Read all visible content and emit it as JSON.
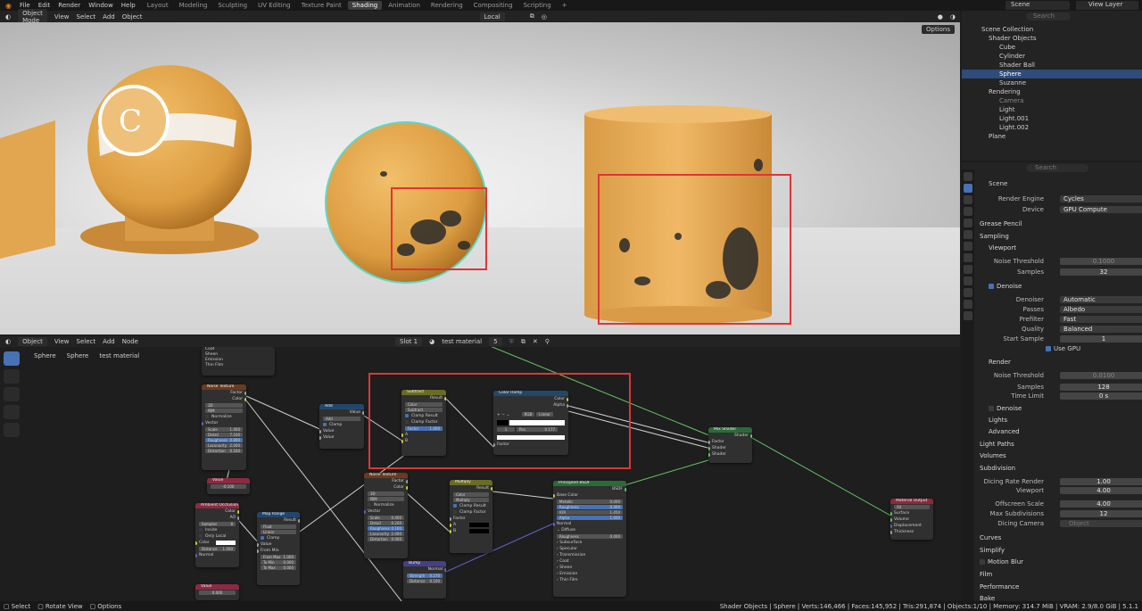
{
  "topbar": {
    "menus": [
      "File",
      "Edit",
      "Render",
      "Window",
      "Help"
    ],
    "workspaces": [
      "Layout",
      "Modeling",
      "Sculpting",
      "UV Editing",
      "Texture Paint",
      "Shading",
      "Animation",
      "Rendering",
      "Compositing",
      "Scripting"
    ],
    "active_workspace": "Shading",
    "scene": "Scene",
    "view_layer": "View Layer"
  },
  "viewport_header": {
    "mode": "Object Mode",
    "menus": [
      "View",
      "Select",
      "Add",
      "Object"
    ],
    "orientation": "Local",
    "options": "Options"
  },
  "outliner": {
    "search_placeholder": "Search",
    "root": "Scene Collection",
    "rows": [
      {
        "label": "Shader Objects"
      },
      {
        "label": "Cube"
      },
      {
        "label": "Cylinder"
      },
      {
        "label": "Shader Ball"
      },
      {
        "label": "Sphere"
      },
      {
        "label": "Suzanne"
      },
      {
        "label": "Rendering"
      },
      {
        "label": "Camera"
      },
      {
        "label": "Light"
      },
      {
        "label": "Light.001"
      },
      {
        "label": "Light.002"
      },
      {
        "label": "Plane"
      }
    ]
  },
  "properties": {
    "search_placeholder": "Search",
    "breadcrumb": "Scene",
    "render_engine_label": "Render Engine",
    "render_engine": "Cycles",
    "device_label": "Device",
    "device": "GPU Compute",
    "grease_pencil": "Grease Pencil",
    "sampling": "Sampling",
    "viewport": "Viewport",
    "noise_threshold_label": "Noise Threshold",
    "vp_noise_threshold": "0.1000",
    "samples_label": "Samples",
    "vp_samples": "32",
    "denoise": "Denoise",
    "denoiser_label": "Denoiser",
    "denoiser": "Automatic",
    "passes_label": "Passes",
    "passes": "Albedo",
    "prefilter_label": "Prefilter",
    "prefilter": "Fast",
    "quality_label": "Quality",
    "quality": "Balanced",
    "start_sample_label": "Start Sample",
    "start_sample": "1",
    "use_gpu": "Use GPU",
    "render": "Render",
    "r_noise_threshold": "0.0100",
    "r_samples": "128",
    "time_limit_label": "Time Limit",
    "time_limit": "0 s",
    "denoise2": "Denoise",
    "lights": "Lights",
    "advanced": "Advanced",
    "light_paths": "Light Paths",
    "volumes": "Volumes",
    "subdivision": "Subdivision",
    "dicing_rate_render_label": "Dicing Rate Render",
    "dicing_rate_render": "1.00",
    "dicing_viewport_label": "Viewport",
    "dicing_viewport": "4.00",
    "offscreen_scale_label": "Offscreen Scale",
    "offscreen_scale": "4.00",
    "max_subdivisions_label": "Max Subdivisions",
    "max_subdivisions": "12",
    "dicing_camera_label": "Dicing Camera",
    "dicing_camera_placeholder": "Object",
    "curves": "Curves",
    "simplify": "Simplify",
    "motion_blur": "Motion Blur",
    "film": "Film",
    "performance": "Performance",
    "bake": "Bake"
  },
  "node_header": {
    "editor_type": "Object",
    "menus": [
      "View",
      "Select",
      "Add",
      "Node"
    ],
    "slot": "Slot 1",
    "material": "test material",
    "users": "5"
  },
  "breadcrumbs": [
    "Sphere",
    "Sphere",
    "test material"
  ],
  "nodes": {
    "noise1": {
      "title": "Noise Texture",
      "out1": "Factor",
      "out2": "Color",
      "dim": "3D",
      "type": "fBM",
      "normalize": "Normalize",
      "vector": "Vector",
      "scale": "Scale",
      "scale_v": "1.400",
      "detail": "Detail",
      "detail_v": "7.100",
      "rough": "Roughness",
      "rough_v": "0.800",
      "lac": "Lacunarity",
      "lac_v": "2.000",
      "dist": "Distortion",
      "dist_v": "0.160"
    },
    "add": {
      "title": "Add",
      "out": "Value",
      "op": "Add",
      "clamp": "Clamp",
      "in1": "Value",
      "in2": "Value"
    },
    "value1": {
      "value": "-0.100"
    },
    "subtract": {
      "title": "Subtract",
      "out": "Result",
      "mode": "Color",
      "op": "Subtract",
      "clamp_result": "Clamp Result",
      "clamp_factor": "Clamp Factor",
      "factor": "Factor",
      "factor_v": "1.000",
      "a": "A",
      "b": "B"
    },
    "ramp": {
      "title": "Color Ramp",
      "out1": "Color",
      "out2": "Alpha",
      "mode": "RGB",
      "interp": "Linear",
      "idx": "1",
      "pos_label": "Pos",
      "pos": "0.177",
      "fac": "Factor"
    },
    "mix": {
      "title": "Mix Shader",
      "out": "Shader",
      "fac": "Factor",
      "s1": "Shader",
      "s2": "Shader"
    },
    "ao": {
      "title": "Ambient Occlusion",
      "out1": "Color",
      "out2": "AO",
      "samples": "Samples",
      "samples_v": "8",
      "inside": "Inside",
      "only_local": "Only Local",
      "color": "Color",
      "distance": "Distance",
      "distance_v": "1.000",
      "normal": "Normal"
    },
    "maprange": {
      "title": "Map Range",
      "out": "Result",
      "type": "Float",
      "interp": "Linear",
      "clamp": "Clamp",
      "value": "Value",
      "from_min": "From Min",
      "from_max": "From Max",
      "from_max_v": "1.000",
      "to_min": "To Min",
      "to_min_v": "0.000",
      "to_max": "To Max",
      "to_max_v": "0.000"
    },
    "noise2": {
      "title": "Noise Texture",
      "out1": "Factor",
      "out2": "Color",
      "dim": "3D",
      "type": "fBM",
      "normalize": "Normalize",
      "vector": "Vector",
      "scale": "Scale",
      "scale_v": "0.400",
      "detail": "Detail",
      "detail_v": "0.200",
      "rough": "Roughness",
      "rough_v": "0.100",
      "lac": "Lacunarity",
      "lac_v": "2.000",
      "dist": "Distortion",
      "dist_v": "0.000"
    },
    "multiply": {
      "title": "Multiply",
      "out": "Result",
      "mode": "Color",
      "op": "Multiply",
      "clamp_result": "Clamp Result",
      "clamp_factor": "Clamp Factor",
      "factor": "Factor",
      "a": "A",
      "b": "B"
    },
    "bump": {
      "title": "Bump",
      "out": "Normal",
      "strength": "Strength",
      "strength_v": "0.270",
      "distance": "Distance",
      "distance_v": "0.100"
    },
    "bsdf": {
      "title": "Principled BSDF",
      "out": "BSDF",
      "base_color": "Base Color",
      "metallic": "Metallic",
      "metallic_v": "0.000",
      "roughness": "Roughness",
      "roughness_v": "0.400",
      "ior": "IOR",
      "ior_v": "1.450",
      "alpha": "Alpha",
      "alpha_v": "1.000",
      "normal": "Normal",
      "diffuse": "Diffuse",
      "rough_label": "Roughness",
      "rough2_v": "0.000",
      "subsurface": "Subsurface",
      "specular": "Specular",
      "transmission": "Transmission",
      "coat": "Coat",
      "sheen": "Sheen",
      "emission": "Emission",
      "thin_film": "Thin Film"
    },
    "output": {
      "title": "Material Output",
      "target": "All",
      "surface": "Surface",
      "volume": "Volume",
      "displacement": "Displacement",
      "thickness": "Thickness"
    },
    "value2": {
      "value": "0.060"
    },
    "frame_top": {
      "items": [
        "Coat",
        "Sheen",
        "Emission",
        "Thin Film"
      ]
    }
  },
  "statusbar": {
    "select": "Select",
    "rotate": "Rotate View",
    "options": "Options",
    "stats": "Shader Objects | Sphere | Verts:146,466 | Faces:145,952 | Tris:291,874 | Objects:1/10 | Memory: 314.7 MiB | VRAM: 2.9/8.0 GiB | 5.1.1"
  },
  "colors": {
    "accent": "#4772b3",
    "highlight_box": "#e03535",
    "material": "#e8a94a"
  }
}
